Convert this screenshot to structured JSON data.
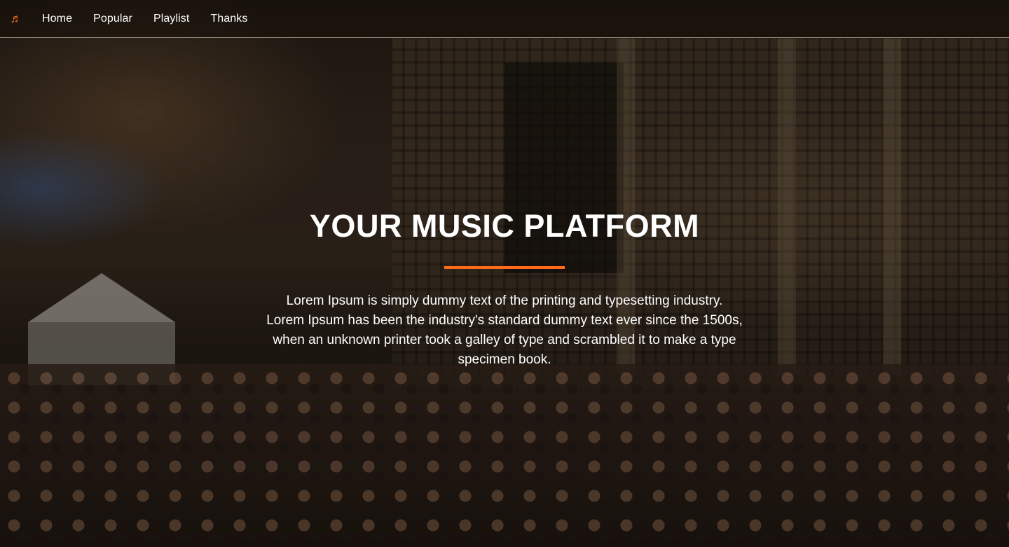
{
  "nav": {
    "brand_icon": "music-note-icon",
    "brand_glyph": "♬",
    "items": [
      {
        "label": "Home"
      },
      {
        "label": "Popular"
      },
      {
        "label": "Playlist"
      },
      {
        "label": "Thanks"
      }
    ]
  },
  "hero": {
    "title": "YOUR MUSIC PLATFORM",
    "description": "Lorem Ipsum is simply dummy text of the printing and typesetting industry. Lorem Ipsum has been the industry's standard dummy text ever since the 1500s, when an unknown printer took a galley of type and scrambled it to make a type specimen book."
  },
  "colors": {
    "accent": "#ff6a1a",
    "text": "#ffffff"
  }
}
